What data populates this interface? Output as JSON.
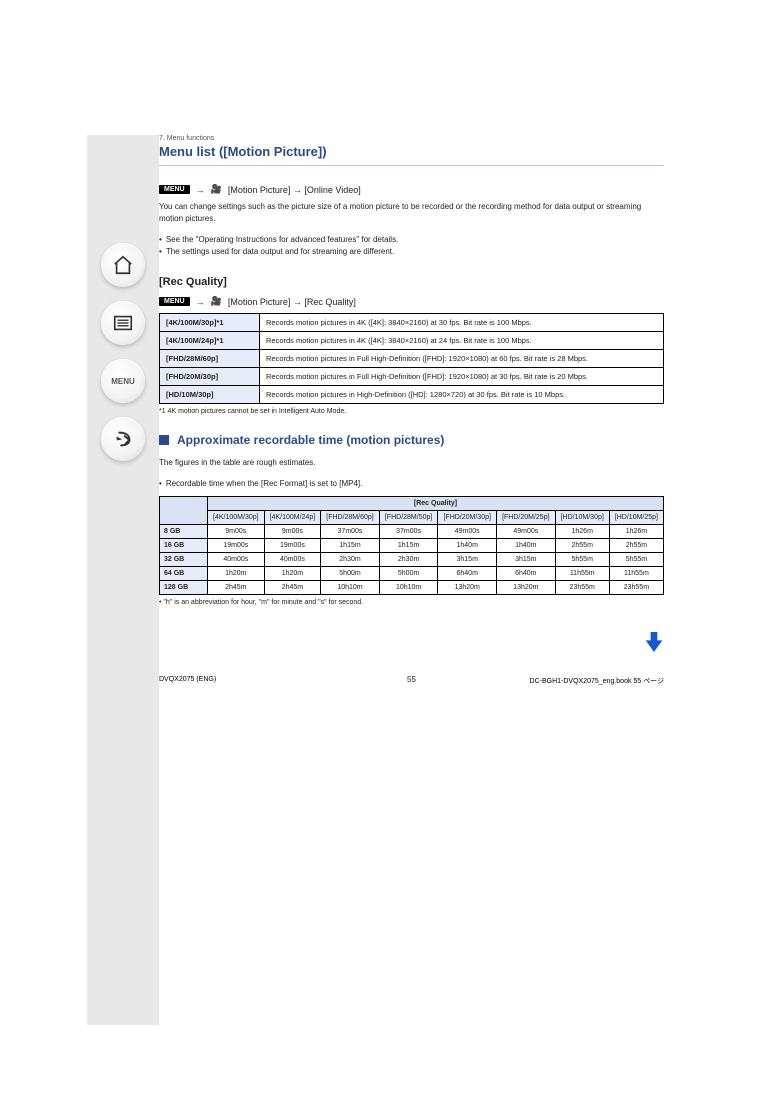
{
  "header": {
    "breadcrumb": "7. Menu functions",
    "page_title": "Menu list ([Motion Picture])"
  },
  "nav": {
    "home": "home-icon",
    "toc": "toc-icon",
    "menu_label": "MENU",
    "back": "back-icon"
  },
  "ov": {
    "menu_badge": "MENU",
    "arrow": "→",
    "path_icon": "🎥",
    "path": "[Motion Picture] → [Online Video]",
    "body": "You can change settings such as the picture size of a motion picture to be recorded or the recording method for data output or streaming motion pictures.",
    "b1": "See the \"Operating Instructions for advanced features\" for details.",
    "b2": "The settings used for data output and for streaming are different."
  },
  "rq": {
    "subhead": "[Rec Quality]",
    "menu_badge": "MENU",
    "arrow": "→",
    "path_icon": "🎥",
    "path": "[Motion Picture] → [Rec Quality]",
    "rows": [
      {
        "label": "[4K/100M/30p]*1",
        "text": "Records motion pictures in 4K ([4K]: 3840×2160) at 30 fps. Bit rate is 100 Mbps."
      },
      {
        "label": "[4K/100M/24p]*1",
        "text": "Records motion pictures in 4K ([4K]: 3840×2160) at 24 fps. Bit rate is 100 Mbps."
      },
      {
        "label": "[FHD/28M/60p]",
        "text": "Records motion pictures in Full High-Definition ([FHD]: 1920×1080) at 60 fps. Bit rate is 28 Mbps."
      },
      {
        "label": "[FHD/20M/30p]",
        "text": "Records motion pictures in Full High-Definition ([FHD]: 1920×1080) at 30 fps. Bit rate is 20 Mbps."
      },
      {
        "label": "[HD/10M/30p]",
        "text": "Records motion pictures in High-Definition ([HD]: 1280×720) at 30 fps. Bit rate is 10 Mbps."
      }
    ],
    "note": "*1 4K motion pictures cannot be set in Intelligent Auto Mode."
  },
  "rt": {
    "section_title": "Approximate recordable time (motion pictures)",
    "intro": "The figures in the table are rough estimates.",
    "b1": "Recordable time when the [Rec Format] is set to [MP4].",
    "cols_title": "[Rec Quality]",
    "cols": [
      "[4K/100M/30p]",
      "[4K/100M/24p]",
      "[FHD/28M/60p]",
      "[FHD/28M/50p]",
      "[FHD/20M/30p]",
      "[FHD/20M/25p]",
      "[HD/10M/30p]",
      "[HD/10M/25p]"
    ],
    "rows": [
      {
        "label": "8 GB",
        "v": [
          "9m00s",
          "9m00s",
          "37m00s",
          "37m00s",
          "49m00s",
          "49m00s",
          "1h26m",
          "1h26m"
        ]
      },
      {
        "label": "16 GB",
        "v": [
          "19m00s",
          "19m00s",
          "1h15m",
          "1h15m",
          "1h40m",
          "1h40m",
          "2h55m",
          "2h55m"
        ]
      },
      {
        "label": "32 GB",
        "v": [
          "40m00s",
          "40m00s",
          "2h30m",
          "2h30m",
          "3h15m",
          "3h15m",
          "5h55m",
          "5h55m"
        ]
      },
      {
        "label": "64 GB",
        "v": [
          "1h20m",
          "1h20m",
          "5h00m",
          "5h00m",
          "6h40m",
          "6h40m",
          "11h55m",
          "11h55m"
        ]
      },
      {
        "label": "128 GB",
        "v": [
          "2h45m",
          "2h45m",
          "10h10m",
          "10h10m",
          "13h20m",
          "13h20m",
          "23h55m",
          "23h55m"
        ]
      }
    ],
    "footnote": "• \"h\" is an abbreviation for hour, \"m\" for minute and \"s\" for second."
  },
  "footer": {
    "left": "DVQX2075 (ENG)",
    "page": "55",
    "right": "DC-BGH1-DVQX2075_eng.book  55 ページ"
  }
}
